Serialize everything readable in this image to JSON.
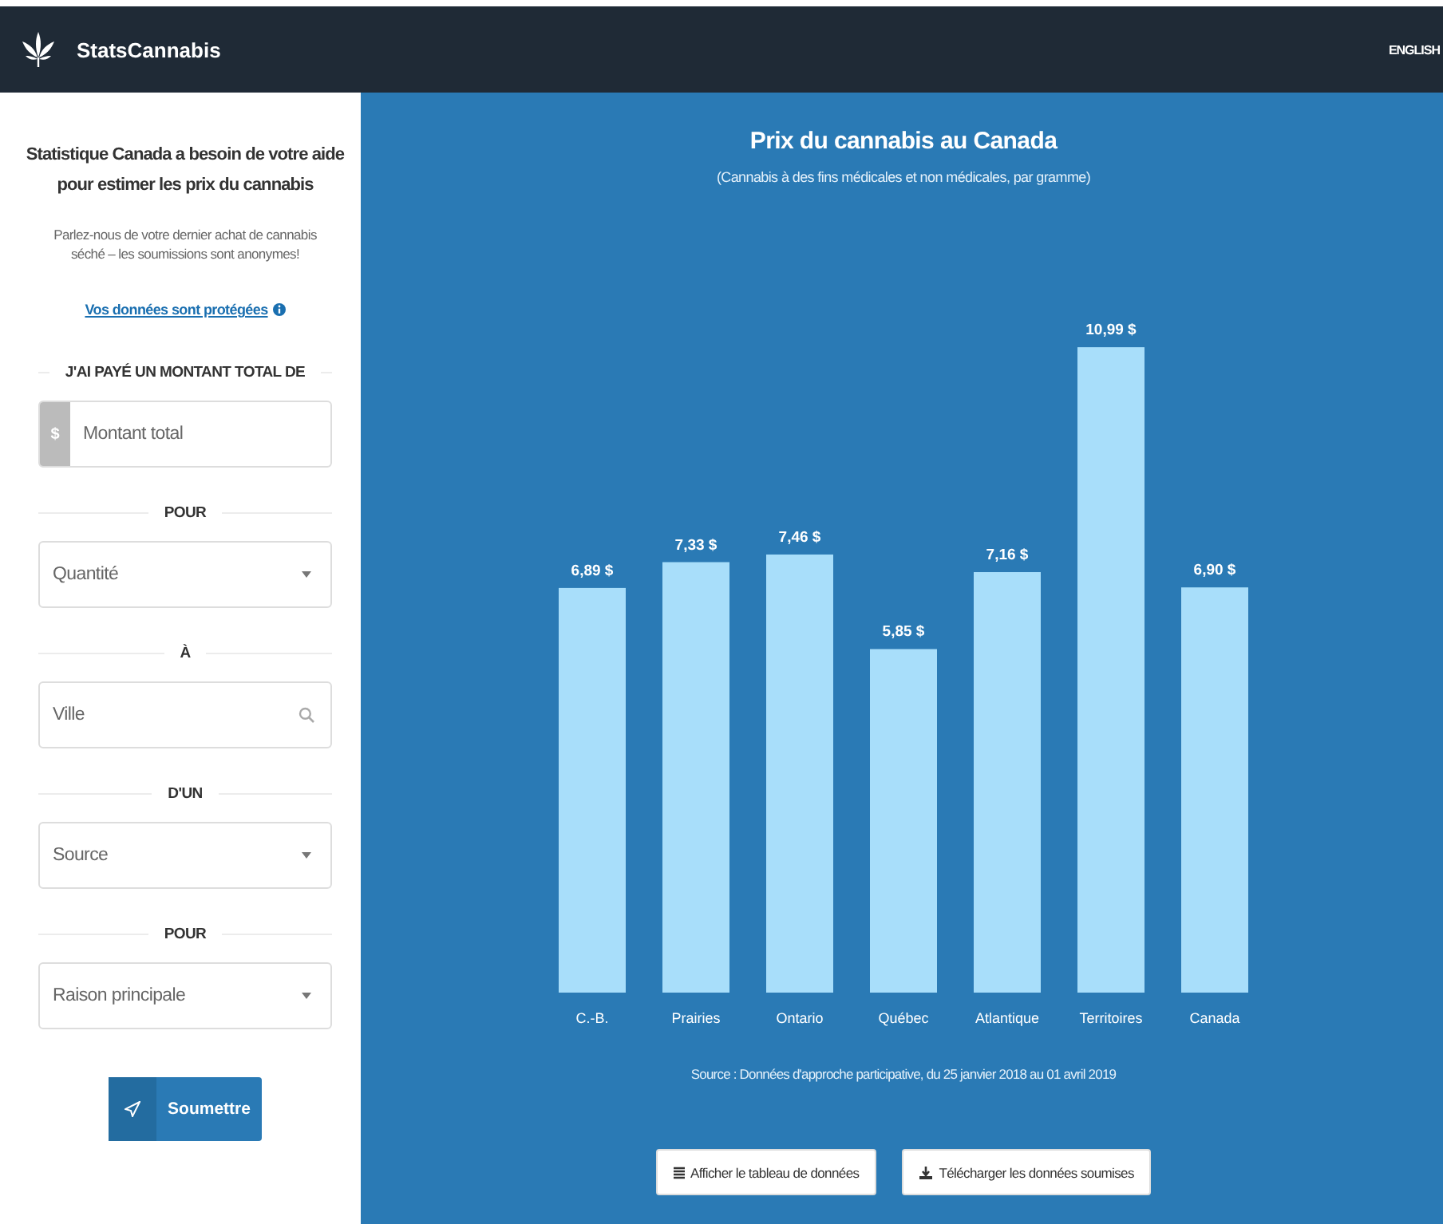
{
  "header": {
    "brand": "StatsCannabis",
    "language_link": "ENGLISH"
  },
  "sidebar": {
    "heading": "Statistique Canada a besoin de votre aide pour estimer les prix du cannabis",
    "intro": "Parlez-nous de votre dernier achat de cannabis séché – les soumissions sont anonymes!",
    "privacy_link": "Vos données sont protégées",
    "form": [
      {
        "kind": "label",
        "text": "J'AI PAYÉ UN MONTANT TOTAL DE"
      },
      {
        "kind": "money",
        "prefix": "$",
        "placeholder": "Montant total"
      },
      {
        "kind": "label",
        "text": "POUR"
      },
      {
        "kind": "select",
        "placeholder": "Quantité"
      },
      {
        "kind": "label",
        "text": "À"
      },
      {
        "kind": "search",
        "placeholder": "Ville"
      },
      {
        "kind": "label",
        "text": "D'UN"
      },
      {
        "kind": "select",
        "placeholder": "Source"
      },
      {
        "kind": "label",
        "text": "POUR"
      },
      {
        "kind": "select",
        "placeholder": "Raison principale"
      }
    ],
    "submit_button": "Soumettre"
  },
  "main": {
    "title": "Prix du cannabis au Canada",
    "subtitle": "(Cannabis à des fins médicales et non médicales, par gramme)",
    "chart_data": {
      "type": "bar",
      "categories": [
        "C.-B.",
        "Prairies",
        "Ontario",
        "Québec",
        "Atlantique",
        "Territoires",
        "Canada"
      ],
      "values": [
        6.89,
        7.33,
        7.46,
        5.85,
        7.16,
        10.99,
        6.9
      ],
      "value_labels": [
        "6,89 $",
        "7,33 $",
        "7,46 $",
        "5,85 $",
        "7,16 $",
        "10,99 $",
        "6,90 $"
      ]
    },
    "source": "Source : Données d'approche participative, du 25 janvier 2018 au 01 avril 2019",
    "buttons": [
      {
        "kind": "table",
        "label": "Afficher le tableau de données"
      },
      {
        "kind": "download",
        "label": "Télécharger les données soumises"
      }
    ]
  }
}
